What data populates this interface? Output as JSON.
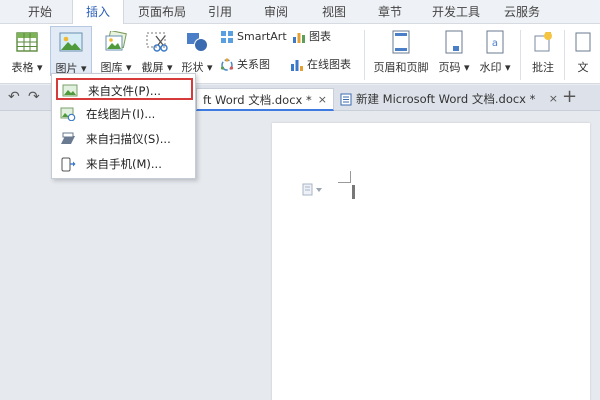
{
  "menubar": {
    "tabs": [
      "开始",
      "插入",
      "页面布局",
      "引用",
      "审阅",
      "视图",
      "章节",
      "开发工具",
      "云服务"
    ],
    "active": "插入"
  },
  "ribbon": {
    "table_label": "表格",
    "picture_label": "图片",
    "gallery_label": "图库",
    "screenshot_label": "截屏",
    "shape_label": "形状",
    "smartart_label": "SmartArt",
    "chart_label": "图表",
    "relation_label": "关系图",
    "online_chart_label": "在线图表",
    "header_footer_label": "页眉和页脚",
    "page_number_label": "页码",
    "watermark_label": "水印",
    "comment_label": "批注",
    "text_label": "文"
  },
  "doc_tabs": [
    {
      "label": "ft Word 文档.docx *",
      "close": "×",
      "active": true
    },
    {
      "label": "新建 Microsoft Word 文档.docx *",
      "close": "×",
      "active": false
    }
  ],
  "tabbar": {
    "add": "+",
    "undo": "↶",
    "redo": "↷"
  },
  "picture_menu": {
    "items": [
      {
        "label": "来自文件(P)...",
        "selected": true
      },
      {
        "label": "在线图片(I)...",
        "selected": false
      },
      {
        "label": "来自扫描仪(S)...",
        "selected": false
      },
      {
        "label": "来自手机(M)...",
        "selected": false
      }
    ]
  },
  "colors": {
    "accent": "#2b5fb8",
    "highlight_box": "#d63a3a",
    "tab_underline": "#3d7be0"
  }
}
